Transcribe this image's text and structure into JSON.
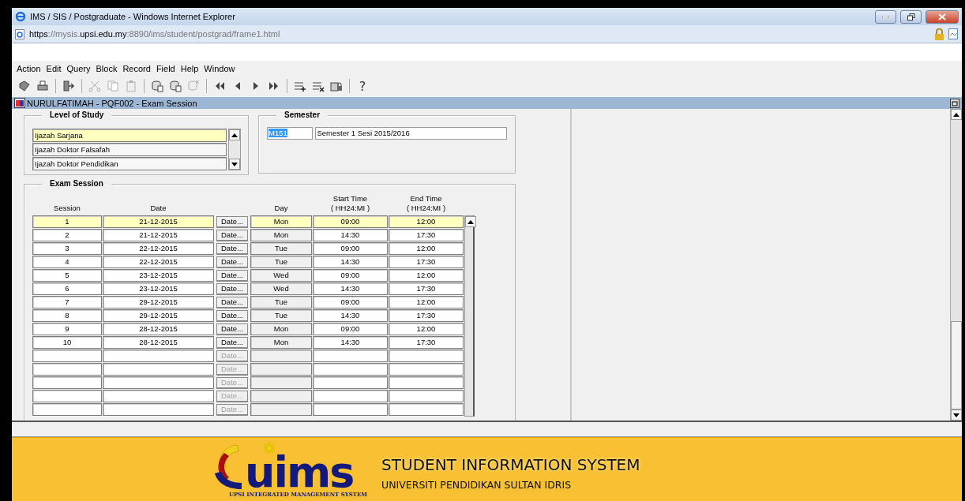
{
  "window": {
    "title": "IMS / SIS / Postgraduate - Windows Internet Explorer"
  },
  "address_bar": {
    "url_parts": [
      {
        "text": "https",
        "emphasis": true
      },
      {
        "text": "://mysis.",
        "emphasis": false
      },
      {
        "text": "upsi.edu.my",
        "emphasis": true
      },
      {
        "text": ":8890/ims/student/postgrad/frame1.html",
        "emphasis": false
      }
    ]
  },
  "menu": [
    "Action",
    "Edit",
    "Query",
    "Block",
    "Record",
    "Field",
    "Help",
    "Window"
  ],
  "toolbar": [
    {
      "kind": "save",
      "disabled": false
    },
    {
      "kind": "print",
      "disabled": false
    },
    {
      "kind": "sep"
    },
    {
      "kind": "exit",
      "disabled": false
    },
    {
      "kind": "sep"
    },
    {
      "kind": "cut",
      "disabled": true
    },
    {
      "kind": "copy",
      "disabled": true
    },
    {
      "kind": "paste",
      "disabled": true
    },
    {
      "kind": "sep"
    },
    {
      "kind": "query",
      "disabled": false
    },
    {
      "kind": "query",
      "disabled": false
    },
    {
      "kind": "query-cancel",
      "disabled": true
    },
    {
      "kind": "sep"
    },
    {
      "kind": "first",
      "disabled": false
    },
    {
      "kind": "prev",
      "disabled": false
    },
    {
      "kind": "next",
      "disabled": false
    },
    {
      "kind": "last",
      "disabled": false
    },
    {
      "kind": "sep"
    },
    {
      "kind": "insert",
      "disabled": false
    },
    {
      "kind": "delete",
      "disabled": false
    },
    {
      "kind": "lock",
      "disabled": false
    },
    {
      "kind": "sep"
    },
    {
      "kind": "help",
      "label": "?",
      "disabled": false
    }
  ],
  "form_title": "NURULFATIMAH - PQF002 - Exam Session",
  "level_of_study": {
    "title": "Level of Study",
    "items": [
      {
        "label": "Ijazah Sarjana",
        "selected": true
      },
      {
        "label": "Ijazah Doktor Falsafah",
        "selected": false
      },
      {
        "label": "Ijazah Doktor Pendidikan",
        "selected": false
      }
    ]
  },
  "semester": {
    "title": "Semester",
    "code": "M151",
    "code_highlighted": true,
    "name": "Semester 1 Sesi 2015/2016"
  },
  "exam_session": {
    "title": "Exam Session",
    "columns": [
      {
        "label": "Session"
      },
      {
        "label": "Date"
      },
      {
        "label": "Day"
      },
      {
        "label": "Start Time",
        "sub": "( HH24:MI )"
      },
      {
        "label": "End Time",
        "sub": "( HH24:MI )"
      }
    ],
    "rows": [
      {
        "session": "1",
        "date": "21-12-2015",
        "date_button": "Date...",
        "day": "Mon",
        "start": "09:00",
        "end": "12:00",
        "selected": true,
        "disabled": false
      },
      {
        "session": "2",
        "date": "21-12-2015",
        "date_button": "Date...",
        "day": "Mon",
        "start": "14:30",
        "end": "17:30",
        "selected": false,
        "disabled": false
      },
      {
        "session": "3",
        "date": "22-12-2015",
        "date_button": "Date...",
        "day": "Tue",
        "start": "09:00",
        "end": "12:00",
        "selected": false,
        "disabled": false
      },
      {
        "session": "4",
        "date": "22-12-2015",
        "date_button": "Date...",
        "day": "Tue",
        "start": "14:30",
        "end": "17:30",
        "selected": false,
        "disabled": false
      },
      {
        "session": "5",
        "date": "23-12-2015",
        "date_button": "Date...",
        "day": "Wed",
        "start": "09:00",
        "end": "12:00",
        "selected": false,
        "disabled": false
      },
      {
        "session": "6",
        "date": "23-12-2015",
        "date_button": "Date...",
        "day": "Wed",
        "start": "14:30",
        "end": "17:30",
        "selected": false,
        "disabled": false
      },
      {
        "session": "7",
        "date": "29-12-2015",
        "date_button": "Date...",
        "day": "Tue",
        "start": "09:00",
        "end": "12:00",
        "selected": false,
        "disabled": false
      },
      {
        "session": "8",
        "date": "29-12-2015",
        "date_button": "Date...",
        "day": "Tue",
        "start": "14:30",
        "end": "17:30",
        "selected": false,
        "disabled": false
      },
      {
        "session": "9",
        "date": "28-12-2015",
        "date_button": "Date...",
        "day": "Mon",
        "start": "09:00",
        "end": "12:00",
        "selected": false,
        "disabled": false
      },
      {
        "session": "10",
        "date": "28-12-2015",
        "date_button": "Date...",
        "day": "Mon",
        "start": "14:30",
        "end": "17:30",
        "selected": false,
        "disabled": false
      },
      {
        "date_button": "Date...",
        "selected": false,
        "disabled": true
      },
      {
        "date_button": "Date...",
        "selected": false,
        "disabled": true
      },
      {
        "date_button": "Date...",
        "selected": false,
        "disabled": true
      },
      {
        "date_button": "Date...",
        "selected": false,
        "disabled": true
      },
      {
        "date_button": "Date...",
        "selected": false,
        "disabled": true
      }
    ]
  },
  "footer": {
    "logo_text": "uims",
    "logo_caption": "UPSI INTEGRATED MANAGEMENT SYSTEM",
    "title": "STUDENT INFORMATION SYSTEM",
    "subtitle": "UNIVERSITI PENDIDIKAN SULTAN IDRIS"
  }
}
